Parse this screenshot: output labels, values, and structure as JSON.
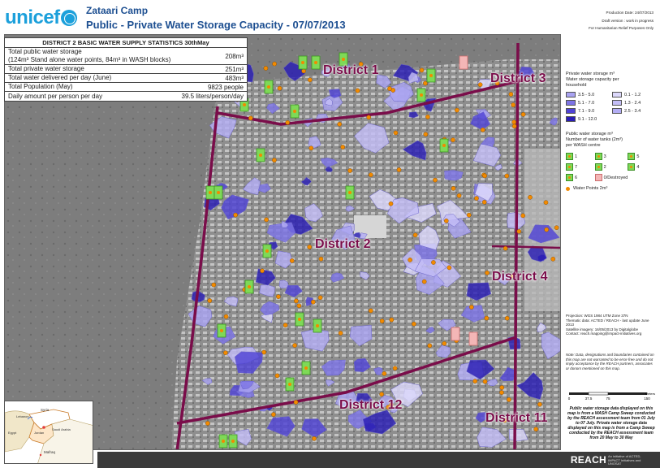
{
  "header": {
    "logo_text": "unicef",
    "camp_title": "Zataari Camp",
    "map_title": "Public - Private Water Storage Capacity -  07/07/2013",
    "production_date": "Production Date: 24/07/2013",
    "draft_note": "Draft version : work in progress",
    "purpose": "For Humanitarian Relief Purposes Only"
  },
  "stats_table": {
    "title": "DISTRICT 2 BASIC WATER SUPPLY STATISTICS 30thMay",
    "rows": [
      {
        "label": "Total public water storage\n(124m³ Stand alone water points, 84m³ in WASH blocks)",
        "value": "208m³"
      },
      {
        "label": "Total private water storage",
        "value": "251m³"
      },
      {
        "label": "Total water delivered per day (June)",
        "value": "483m³"
      },
      {
        "label": "Total Population (May)",
        "value": "9823 people"
      },
      {
        "label": "Daily amount per person per day",
        "value": "39.5 liters/person/day"
      }
    ]
  },
  "districts": [
    {
      "name": "District 1"
    },
    {
      "name": "District 3"
    },
    {
      "name": "District 2"
    },
    {
      "name": "District 4"
    },
    {
      "name": "District 12"
    },
    {
      "name": "District 11"
    }
  ],
  "legend": {
    "private_title": "Private water storage m³\nWater storage capacity per\nhousehold",
    "private_classes": [
      {
        "label": "3.5 - 5.0",
        "color": "#a9a3f2"
      },
      {
        "label": "0.1 - 1.2",
        "color": "#dcd8fb"
      },
      {
        "label": "5.1 - 7.0",
        "color": "#7d74e6"
      },
      {
        "label": "1.3 - 2.4",
        "color": "#c3bdf6"
      },
      {
        "label": "7.1 - 9.0",
        "color": "#4f43d6"
      },
      {
        "label": "2.5 - 3.4",
        "color": "#b3adf4"
      },
      {
        "label": "9.1 - 12.0",
        "color": "#2a1db5"
      }
    ],
    "public_title": "Public water storage m³\nNumber of water tanks (2m³)\nper WASH centre",
    "tank_classes": [
      "1",
      "3",
      "5",
      "7",
      "2",
      "4",
      "6",
      "0/Destroyed"
    ],
    "water_points_label": "Water Points 2m³"
  },
  "info": {
    "projection": "Projection: WGS 1984 UTM Zone 37N",
    "thematic": "Thematic data: ACTED / REACH - last update June 2013",
    "satellite": "Satellite imagery: 16/05/2013 by Digitalglobe",
    "contact": "Contact: reach.mapping@impact-initiatives.org"
  },
  "disclaimer": "Note: Data, designations and boundaries contained on this map are not warranted to be error-free and do not imply acceptance by the REACH partners, associates or donors mentioned on this map.",
  "scale": {
    "ticks": [
      "0",
      "37.5",
      "75",
      "150"
    ],
    "unit": "Meters"
  },
  "note": "Public water storage data displayed on this map is from a WASH Camp Sweep conducted by the REACH assessment team from 01 July to 07 July. Private water storage data displayed on this map is from a Camp Sweep conducted by the REACH assessment team from 20 May to 30 May",
  "inset": {
    "places": [
      "Syria",
      "Lebanon",
      "Jordan",
      "Saudi Arabia",
      "Egypt",
      "Mafraq"
    ]
  },
  "footer": {
    "reach": "REACH",
    "tagline": "An initiative of ACTED, IMPACT Initiatives and UNOSAT"
  },
  "colors": {
    "district_boundary": "#7a0d4a",
    "district_label": "#7a0d4a",
    "title_blue": "#1d4f91",
    "unicef_blue": "#1ca0db",
    "tank_green": "#7ed957",
    "tank_destroyed": "#f3b6b6",
    "water_point": "#f28a00"
  }
}
